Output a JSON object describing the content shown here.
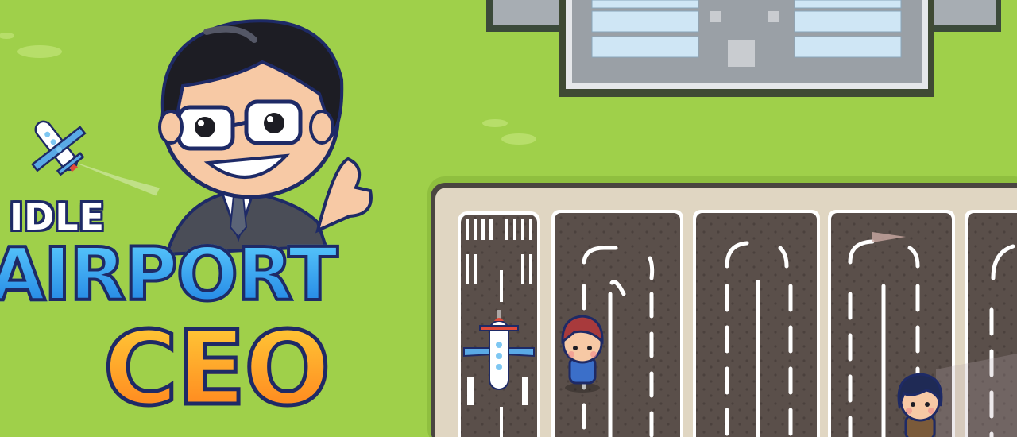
{
  "game": {
    "logo": {
      "line1": "IDLE",
      "line2": "AIRPORT",
      "line3": "CEO"
    }
  },
  "colors": {
    "grass": "#9fd04a",
    "tarmac": "#5a4f4a",
    "apron": "#e0d6c2",
    "terminal": "#9aa0a6",
    "logo_blue": "#1a7be0",
    "logo_orange": "#ff7a1a"
  },
  "icons": [
    "airplane-icon",
    "ceo-character",
    "passenger-character"
  ]
}
